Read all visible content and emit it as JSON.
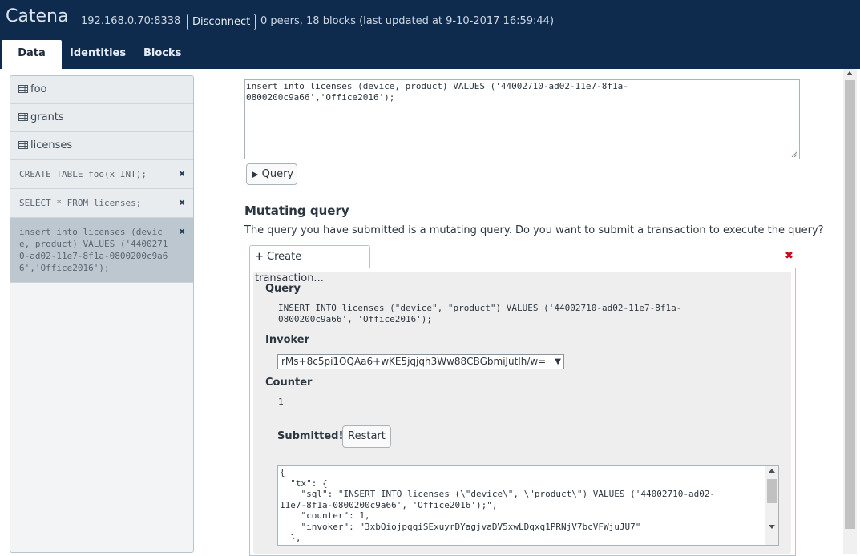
{
  "header": {
    "brand": "Catena",
    "address": "192.168.0.70:8338",
    "disconnect_label": "Disconnect",
    "status": "0 peers, 18 blocks (last updated at 9-10-2017 16:59:44)"
  },
  "tabs": [
    {
      "label": "Data",
      "active": true
    },
    {
      "label": "Identities",
      "active": false
    },
    {
      "label": "Blocks",
      "active": false
    }
  ],
  "sidebar": {
    "tables": [
      {
        "label": "foo"
      },
      {
        "label": "grants"
      },
      {
        "label": "licenses"
      }
    ],
    "queries": [
      {
        "text": "CREATE TABLE foo(x INT);"
      },
      {
        "text": "SELECT * FROM licenses;"
      },
      {
        "text": "insert into licenses (device, product) VALUES ('44002710-ad02-11e7-8f1a-0800200c9a66','Office2016');",
        "selected": true
      }
    ]
  },
  "editor": {
    "line1": "insert into licenses (device, product) VALUES ('44002710-ad02-11e7-8f1a-",
    "line2": "0800200c9a66','Office2016');"
  },
  "query_button_label": "Query",
  "mutating": {
    "title": "Mutating query",
    "description": "The query you have submitted is a mutating query. Do you want to submit a transaction to execute the query?"
  },
  "transaction": {
    "tab_label": "Create transaction...",
    "query_label": "Query",
    "query_line1": "INSERT INTO licenses (\"device\", \"product\") VALUES ('44002710-ad02-11e7-8f1a-",
    "query_line2": "0800200c9a66', 'Office2016');",
    "invoker_label": "Invoker",
    "invoker_value": "rMs+8c5pi1OQAa6+wKE5jqjqh3Ww88CBGbmiJutlh/w=",
    "counter_label": "Counter",
    "counter_value": "1",
    "submitted_label": "Submitted!",
    "restart_label": "Restart",
    "json_text": "{\n  \"tx\": {\n    \"sql\": \"INSERT INTO licenses (\\\"device\\\", \\\"product\\\") VALUES ('44002710-ad02-\n11e7-8f1a-0800200c9a66', 'Office2016');\",\n    \"counter\": 1,\n    \"invoker\": \"3xbQiojpqqiSExuyrDYagjvaDV5xwLDqxq1PRNjV7bcVFWjuJU7\"\n  },"
  },
  "colors": {
    "header_bg": "#0e2a4d",
    "error_red": "#d0021b"
  }
}
